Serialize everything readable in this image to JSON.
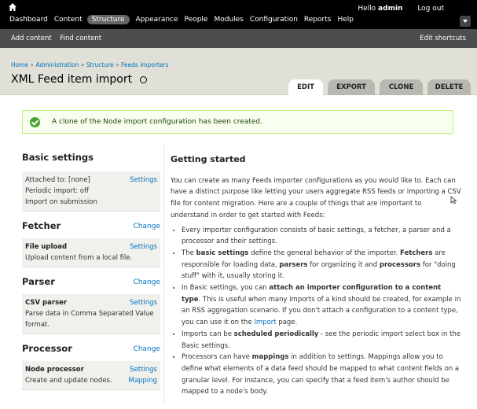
{
  "toolbar": {
    "menu": [
      "Dashboard",
      "Content",
      "Structure",
      "Appearance",
      "People",
      "Modules",
      "Configuration",
      "Reports",
      "Help"
    ],
    "active": "Structure",
    "hello": "Hello",
    "user": "admin",
    "logout": "Log out"
  },
  "shortcuts": {
    "links": [
      "Add content",
      "Find content"
    ],
    "edit": "Edit shortcuts"
  },
  "header": {
    "breadcrumb": [
      "Home",
      "Administration",
      "Structure",
      "Feeds importers"
    ],
    "title": "XML Feed item import",
    "tabs": [
      "EDIT",
      "EXPORT",
      "CLONE",
      "DELETE"
    ],
    "active_tab": "EDIT"
  },
  "message": "A clone of the Node import configuration has been created.",
  "basic": {
    "title": "Basic settings",
    "lines": [
      "Attached to: [none]",
      "Periodic import: off",
      "Import on submission"
    ],
    "settings": "Settings"
  },
  "fetcher": {
    "title": "Fetcher",
    "change": "Change",
    "name": "File upload",
    "settings": "Settings",
    "desc": "Upload content from a local file."
  },
  "parser": {
    "title": "Parser",
    "change": "Change",
    "name": "CSV parser",
    "settings": "Settings",
    "desc_lines": [
      "Parse data in Comma Separated Value",
      "format."
    ]
  },
  "processor": {
    "title": "Processor",
    "change": "Change",
    "name": "Node processor",
    "settings": "Settings",
    "mapping": "Mapping",
    "desc": "Create and update nodes."
  },
  "getting_started": {
    "title": "Getting started",
    "intro": "You can create as many Feeds importer configurations as you would like to. Each can have a distinct purpose like letting your users aggregate RSS feeds or importing a CSV file for content migration. Here are a couple of things that are important to understand in order to get started with Feeds:",
    "b1": "Every importer configuration consists of basic settings, a fetcher, a parser and a processor and their settings.",
    "b2": [
      "The ",
      "basic settings",
      " define the general behavior of the importer. ",
      "Fetchers",
      " are responsible for loading data, ",
      "parsers",
      " for organizing it and ",
      "processors",
      " for \"doing stuff\" with it, usually storing it."
    ],
    "b3": [
      "In Basic settings, you can ",
      "attach an importer configuration to a content type",
      ". This is useful when many imports of a kind should be created, for example in an RSS aggregation scenario. If you don't attach a configuration to a content type, you can use it on the ",
      "Import",
      " page."
    ],
    "b4": [
      "Imports can be ",
      "scheduled periodically",
      " - see the periodic import select box in the Basic settings."
    ],
    "b5": [
      "Processors can have ",
      "mappings",
      " in addition to settings. Mappings allow you to define what elements of a data feed should be mapped to what content fields on a granular level. For instance, you can specify that a feed item's author should be mapped to a node's body."
    ]
  },
  "colors": {
    "link": "#0074bd",
    "toolbar": "#000000",
    "message_border": "#bbee77"
  }
}
